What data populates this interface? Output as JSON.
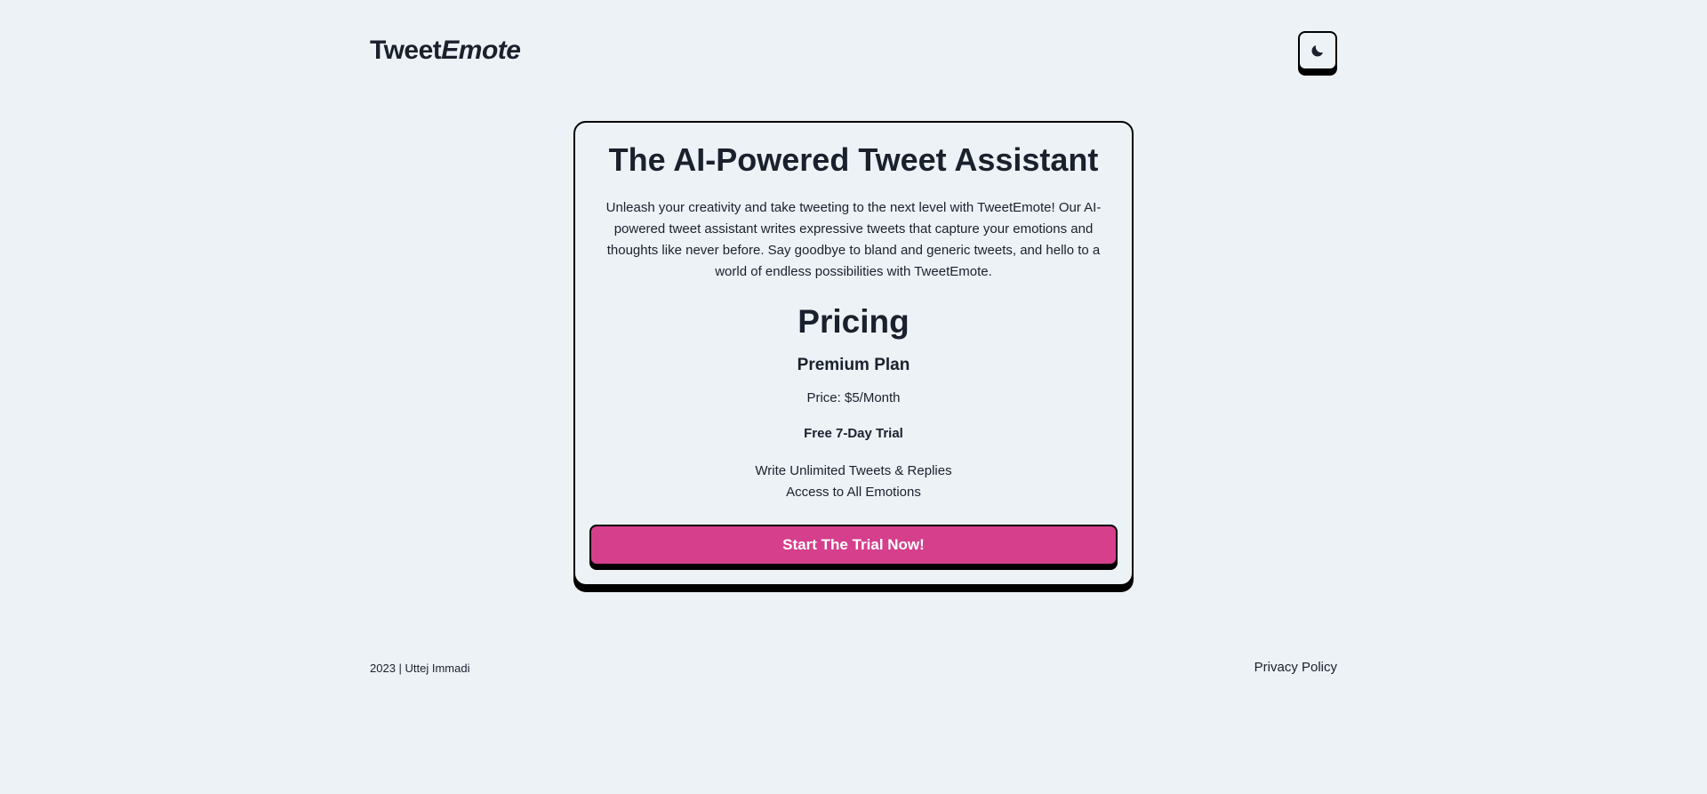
{
  "header": {
    "logo_regular": "Tweet",
    "logo_italic": "Emote",
    "theme_toggle_icon": "moon-icon"
  },
  "card": {
    "title": "The AI-Powered Tweet Assistant",
    "description": "Unleash your creativity and take tweeting to the next level with TweetEmote! Our AI-powered tweet assistant writes expressive tweets that capture your emotions and thoughts like never before. Say goodbye to bland and generic tweets, and hello to a world of endless possibilities with TweetEmote.",
    "pricing_heading": "Pricing",
    "plan_name": "Premium Plan",
    "price": "Price: $5/Month",
    "trial": "Free 7-Day Trial",
    "features": [
      "Write Unlimited Tweets & Replies",
      "Access to All Emotions"
    ],
    "cta_label": "Start The Trial Now!"
  },
  "footer": {
    "credit": "2023 | Uttej Immadi",
    "privacy_link": "Privacy Policy"
  },
  "colors": {
    "background": "#edf2f7",
    "text": "#1a202c",
    "accent": "#d53f8c",
    "border": "#000000"
  }
}
